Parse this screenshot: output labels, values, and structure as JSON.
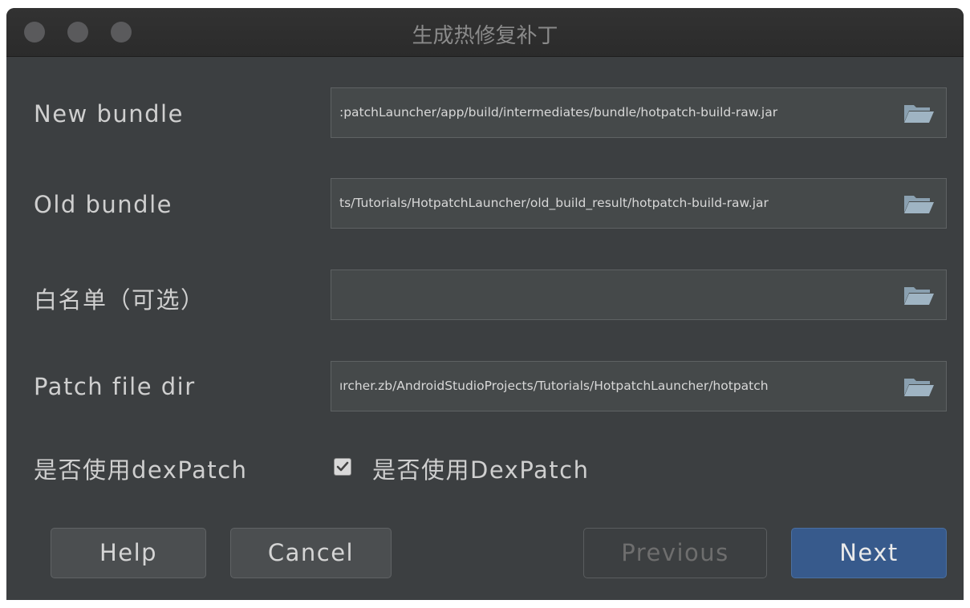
{
  "window": {
    "title": "生成热修复补丁"
  },
  "form": {
    "new_bundle": {
      "label": "New bundle",
      "value": ":patchLauncher/app/build/intermediates/bundle/hotpatch-build-raw.jar"
    },
    "old_bundle": {
      "label": "Old bundle",
      "value": "ts/Tutorials/HotpatchLauncher/old_build_result/hotpatch-build-raw.jar"
    },
    "whitelist": {
      "label": "白名单（可选）",
      "value": ""
    },
    "patch_dir": {
      "label": "Patch file dir",
      "value": "ırcher.zb/AndroidStudioProjects/Tutorials/HotpatchLauncher/hotpatch"
    },
    "dexpatch": {
      "label": "是否使用dexPatch",
      "checkbox_label": "是否使用DexPatch",
      "checked": true
    }
  },
  "buttons": {
    "help": "Help",
    "cancel": "Cancel",
    "previous": "Previous",
    "next": "Next"
  },
  "colors": {
    "background": "#3c3f41",
    "titlebar": "#2b2b2b",
    "field_bg": "#45494a",
    "primary_button": "#375a8c",
    "folder_icon": "#8aa0b0"
  },
  "icons": {
    "folder": "folder-open-icon",
    "check": "check-icon"
  }
}
